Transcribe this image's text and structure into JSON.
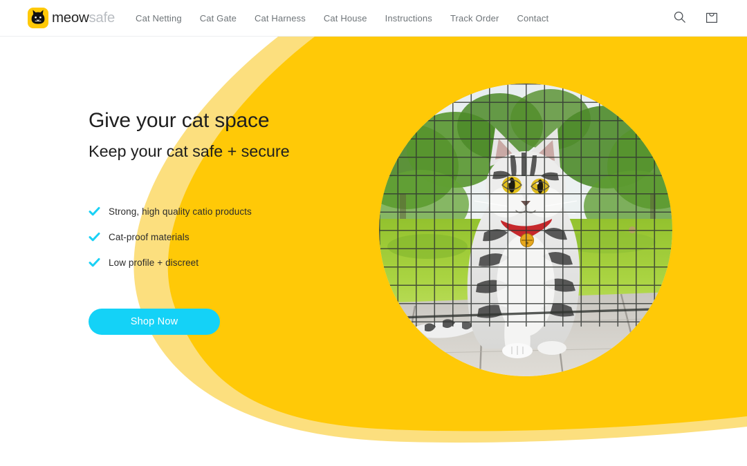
{
  "header": {
    "brand": {
      "word_primary": "meow",
      "word_secondary": "safe",
      "logo_icon": "cat-head-icon"
    },
    "nav": [
      {
        "label": "Cat Netting"
      },
      {
        "label": "Cat Gate"
      },
      {
        "label": "Cat Harness"
      },
      {
        "label": "Cat House"
      },
      {
        "label": "Instructions"
      },
      {
        "label": "Track Order"
      },
      {
        "label": "Contact"
      }
    ],
    "actions": [
      {
        "name": "search-icon",
        "label": "Search"
      },
      {
        "name": "shopping-bag-icon",
        "label": "Cart"
      }
    ]
  },
  "hero": {
    "headline": "Give your cat space",
    "subhead": "Keep your cat safe + secure",
    "benefits": [
      {
        "text": "Strong, high quality catio products"
      },
      {
        "text": "Cat-proof materials"
      },
      {
        "text": "Low profile + discreet"
      }
    ],
    "cta_label": "Shop Now",
    "image_alt": "Silver tabby cat sitting on a wooden deck behind black cat netting with green lawn and trees behind"
  },
  "colors": {
    "yellow": "#FFC907",
    "yellow_light": "#FCDF7E",
    "cyan": "#14d2f7",
    "check_cyan": "#1ad1f5",
    "text_dark": "#1f1f1f",
    "nav_gray": "#6e7478",
    "brand_gray": "#b9bdc2",
    "white": "#ffffff"
  }
}
